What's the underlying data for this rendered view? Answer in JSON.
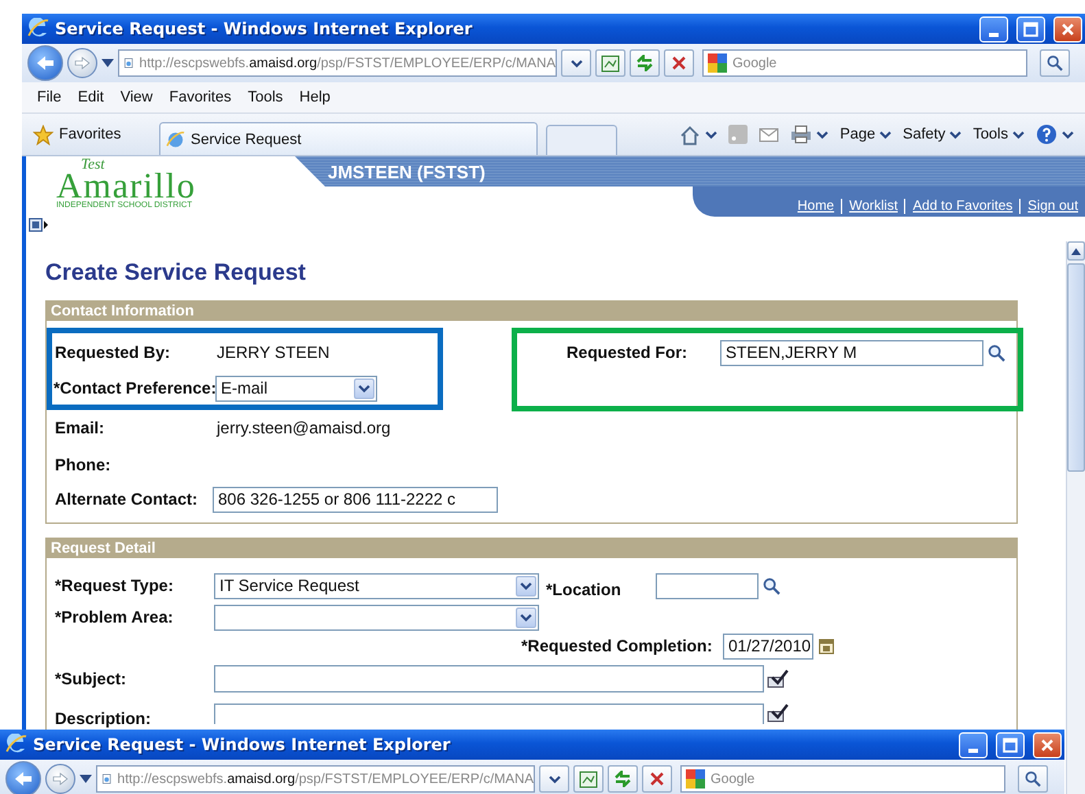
{
  "main_window": {
    "title": "Service Request - Windows Internet Explorer",
    "address": {
      "prefix": "http://escpswebfs.",
      "domain": "amaisd.org",
      "path": "/psp/FSTST/EMPLOYEE/ERP/c/MANA"
    },
    "search": {
      "placeholder": "Google"
    },
    "menu": [
      "File",
      "Edit",
      "View",
      "Favorites",
      "Tools",
      "Help"
    ],
    "favorites_bar": {
      "favorites": "Favorites",
      "tabs": [
        {
          "label": "Service Request",
          "selected": true
        }
      ],
      "commands": [
        "Page",
        "Safety",
        "Tools"
      ]
    }
  },
  "portal": {
    "logo": {
      "tag": "Test",
      "name": "Amarillo",
      "subtitle": "INDEPENDENT SCHOOL DISTRICT"
    },
    "user": "JMSTEEN (FSTST)",
    "nav": [
      "Home",
      "Worklist",
      "Add to Favorites",
      "Sign out"
    ],
    "page_title": "Create Service Request",
    "contact": {
      "title": "Contact Information",
      "requested_by": {
        "label": "Requested By:",
        "value": "JERRY STEEN"
      },
      "requested_for": {
        "label": "Requested For:",
        "value": "STEEN,JERRY M"
      },
      "contact_preference": {
        "label": "*Contact Preference:",
        "value": "E-mail"
      },
      "email": {
        "label": "Email:",
        "value": "jerry.steen@amaisd.org"
      },
      "phone": {
        "label": "Phone:"
      },
      "alternate_contact": {
        "label": "Alternate Contact:",
        "value": "806 326-1255 or 806 111-2222 c"
      },
      "highlights": [
        {
          "color": "#0a6cc0"
        },
        {
          "color": "#0cb04a"
        }
      ]
    },
    "detail": {
      "title": "Request Detail",
      "request_type": {
        "label": "*Request Type:",
        "value": "IT Service Request"
      },
      "location": {
        "label": "*Location"
      },
      "problem_area": {
        "label": "*Problem Area:"
      },
      "requested_completion": {
        "label": "*Requested Completion:",
        "value": "01/27/2010"
      },
      "subject": {
        "label": "*Subject:"
      },
      "description": {
        "label": "Description:"
      }
    }
  },
  "background_window": {
    "title": "Service Request - Windows Internet Explorer",
    "address": {
      "prefix": "http://escpswebfs.",
      "domain": "amaisd.org",
      "path": "/psp/FSTST/EMPLOYEE/ERP/c/MANA"
    },
    "search": {
      "placeholder": "Google"
    }
  }
}
